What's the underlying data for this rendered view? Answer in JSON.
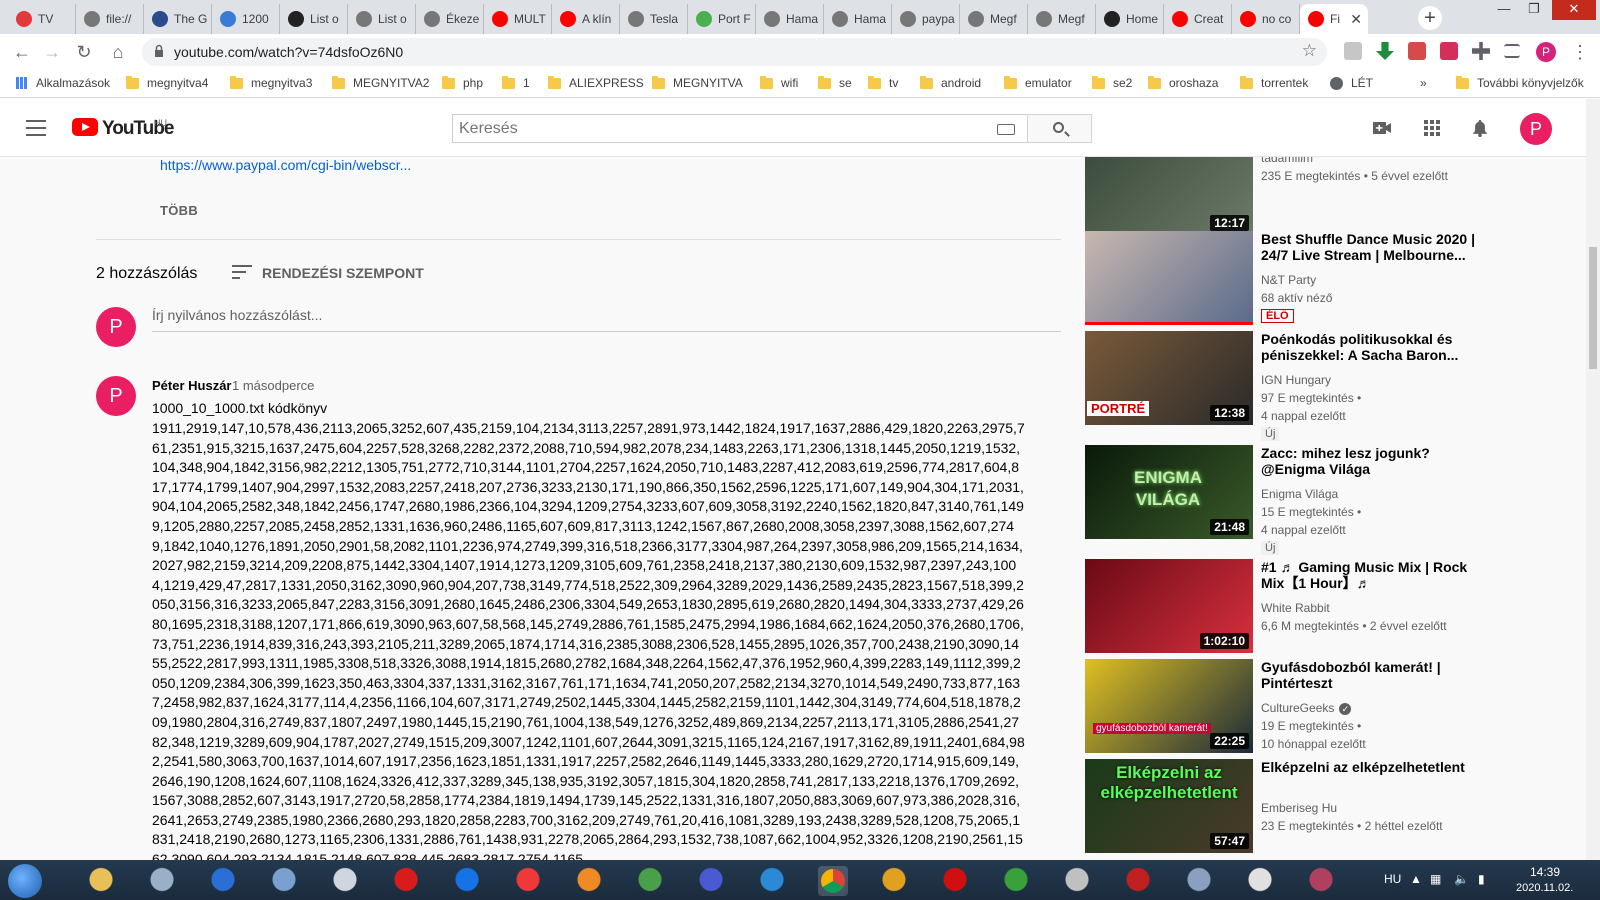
{
  "browser": {
    "tabs": [
      {
        "label": "TV",
        "favicon_color": "#e23a3a"
      },
      {
        "label": "file://",
        "favicon_color": "#777777"
      },
      {
        "label": "The G",
        "favicon_color": "#2a4b8d"
      },
      {
        "label": "1200",
        "favicon_color": "#3a7bd5"
      },
      {
        "label": "List o",
        "favicon_color": "#222222"
      },
      {
        "label": "List o",
        "favicon_color": "#777777"
      },
      {
        "label": "Ékeze",
        "favicon_color": "#777777"
      },
      {
        "label": "MULT",
        "favicon_color": "#ff0000"
      },
      {
        "label": "A klín",
        "favicon_color": "#ff0000"
      },
      {
        "label": "Tesla",
        "favicon_color": "#777777"
      },
      {
        "label": "Port F",
        "favicon_color": "#4caf50"
      },
      {
        "label": "Hama",
        "favicon_color": "#777777"
      },
      {
        "label": "Hama",
        "favicon_color": "#777777"
      },
      {
        "label": "paypa",
        "favicon_color": "#777777"
      },
      {
        "label": "Megf",
        "favicon_color": "#777777"
      },
      {
        "label": "Megf",
        "favicon_color": "#777777"
      },
      {
        "label": "Home",
        "favicon_color": "#222222"
      },
      {
        "label": "Creat",
        "favicon_color": "#ff0000"
      },
      {
        "label": "no co",
        "favicon_color": "#ff0000"
      },
      {
        "label": "Fi",
        "favicon_color": "#ff0000"
      }
    ],
    "new_tab": "+",
    "url": "youtube.com/watch?v=74dsfoOz6N0",
    "bookmarks": [
      "Alkalmazások",
      "megnyitva4",
      "megnyitva3",
      "MEGNYITVA2",
      "php",
      "1",
      "ALIEXPRESS",
      "MEGNYITVA",
      "wifi",
      "se",
      "tv",
      "android",
      "emulator",
      "se2",
      "oroshaza",
      "torrentek",
      "LÉT",
      "»",
      "További könyvjelzők"
    ],
    "profile_letter": "P"
  },
  "youtube": {
    "logo_text": "YouTube",
    "country_code": "HU",
    "search_placeholder": "Keresés",
    "avatar_letter": "P"
  },
  "main": {
    "desc_link": "https://www.paypal.com/cgi-bin/webscr...",
    "more_label": "TÖBB",
    "comment_count": "2 hozzászólás",
    "sort_label": "RENDEZÉSI SZEMPONT",
    "add_comment_placeholder": "Írj nyilvános hozzászólást...",
    "add_avatar": "P",
    "comment": {
      "avatar": "P",
      "author": "Péter Huszár",
      "time": "1 másodperce",
      "title": "1000_10_1000.txt kódkönyv",
      "body": "1911,2919,147,10,578,436,2113,2065,3252,607,435,2159,104,2134,3113,2257,2891,973,1442,1824,1917,1637,2886,429,1820,2263,2975,761,2351,915,3215,1637,2475,604,2257,528,3268,2282,2372,2088,710,594,982,2078,234,1483,2263,171,2306,1318,1445,2050,1219,1532,104,348,904,1842,3156,982,2212,1305,751,2772,710,3144,1101,2704,2257,1624,2050,710,1483,2287,412,2083,619,2596,774,2817,604,817,1774,1799,1407,904,2997,1532,2083,2257,2418,207,2736,3233,2130,171,190,866,350,1562,2596,1225,171,607,149,904,304,171,2031,904,104,2065,2582,348,1842,2456,1747,2680,1986,2366,104,3294,1209,2754,3233,607,609,3058,3192,2240,1562,1820,847,3140,761,1499,1205,2880,2257,2085,2458,2852,1331,1636,960,2486,1165,607,609,817,3113,1242,1567,867,2680,2008,3058,2397,3088,1562,607,2749,1842,1040,1276,1891,2050,2901,58,2082,1101,2236,974,2749,399,316,518,2366,3177,3304,987,264,2397,3058,986,209,1565,214,1634,2027,982,2159,3214,209,2208,875,1442,3304,1407,1914,1273,1209,3105,609,761,2358,2418,2137,380,2130,609,1532,987,2397,243,1004,1219,429,47,2817,1331,2050,3162,3090,960,904,207,738,3149,774,518,2522,309,2964,3289,2029,1436,2589,2435,2823,1567,518,399,2050,3156,316,3233,2065,847,2283,3156,3091,2680,1645,2486,2306,3304,549,2653,1830,2895,619,2680,2820,1494,304,3333,2737,429,2680,1695,2318,3188,1207,171,866,619,3090,963,607,58,568,145,2749,2886,761,1585,2475,2994,1986,1684,662,1624,2050,376,2680,1706,73,751,2236,1914,839,316,243,393,2105,211,3289,2065,1874,1714,316,2385,3088,2306,528,1455,2895,1026,357,700,2438,2190,3090,1455,2522,2817,993,1311,1985,3308,518,3326,3088,1914,1815,2680,2782,1684,348,2264,1562,47,376,1952,960,4,399,2283,149,1112,399,2050,1209,2384,306,399,1623,350,463,3304,337,1331,3162,3167,761,171,1634,741,2050,207,2582,2134,3270,1014,549,2490,733,877,1637,2458,982,837,1624,3177,114,4,2356,1166,104,607,3171,2749,2502,1445,3304,1445,2582,2159,1101,1442,304,3149,774,604,518,1878,209,1980,2804,316,2749,837,1807,2497,1980,1445,15,2190,761,1004,138,549,1276,3252,489,869,2134,2257,2113,171,3105,2886,2541,2782,348,1219,3289,609,904,1787,2027,2749,1515,209,3007,1242,1101,607,2644,3091,3215,1165,124,2167,1917,3162,89,1911,2401,684,982,2541,580,3063,700,1637,1014,607,1917,2356,1623,1851,1331,1917,2257,2582,2646,1149,1445,3333,280,1629,2720,1714,915,609,149,2646,190,1208,1624,607,1108,1624,3326,412,337,3289,345,138,935,3192,3057,1815,304,1820,2858,741,2817,133,2218,1376,1709,2692,1567,3088,2852,607,3143,1917,2720,58,2858,1774,2384,1819,1494,1739,145,2522,1331,316,1807,2050,883,3069,607,973,386,2028,316,2641,2653,2749,2385,1980,2366,2680,293,1820,2858,2283,700,3162,209,2749,761,20,416,1081,3289,193,2438,3289,528,1208,75,2065,1831,2418,2190,2680,1273,1165,2306,1331,2886,761,1438,931,2278,2065,2864,293,1532,738,1087,662,1004,952,3326,1208,2190,2561,1562,3090,604,293,2134,1815,2148,607,828,445,2683,2817,2754,1165"
    }
  },
  "sidebar": {
    "videos": [
      {
        "title": "",
        "channel": "tadamfilm",
        "meta1": "235 E megtekintés • 5 évvel ezelőtt",
        "meta2": "",
        "duration": "12:17",
        "badge": "",
        "thumb_colors": [
          "#3a4a3a",
          "#6c7a68"
        ]
      },
      {
        "title": "Best Shuffle Dance Music 2020 | 24/7 Live Stream | Melbourne...",
        "channel": "N&T Party",
        "meta1": "68 aktív néző",
        "meta2": "",
        "duration": "",
        "badge": "ÉLŐ",
        "thumb_colors": [
          "#c8b8b0",
          "#5a6a8a"
        ]
      },
      {
        "title": "Poénkodás politikusokkal és péniszekkel: A Sacha Baron...",
        "channel": "IGN Hungary",
        "meta1": "97 E megtekintés •",
        "meta2": "4 nappal ezelőtt",
        "duration": "12:38",
        "badge": "Új",
        "overlay": "PORTRÉ",
        "thumb_colors": [
          "#7a5a3a",
          "#2a2a2a"
        ]
      },
      {
        "title": "Zacc: mihez lesz jogunk? @Enigma Világa",
        "channel": "Enigma Világa",
        "meta1": "15 E megtekintés •",
        "meta2": "4 nappal ezelőtt",
        "duration": "21:48",
        "badge": "Új",
        "overlay": "ENIGMA VILÁGA",
        "thumb_colors": [
          "#0a1a0a",
          "#3a5a2a"
        ]
      },
      {
        "title": "#1 ♬ Gaming Music Mix | Rock Mix【1 Hour】♬",
        "channel": "White Rabbit",
        "meta1": "6,6 M megtekintés • 2 évvel ezelőtt",
        "meta2": "",
        "duration": "1:02:10",
        "badge": "",
        "thumb_colors": [
          "#6a0a14",
          "#d83040"
        ]
      },
      {
        "title": "Gyufásdobozból kamerát! | Pintérteszt",
        "channel": "CultureGeeks",
        "meta1": "19 E megtekintés •",
        "meta2": "10 hónappal ezelőtt",
        "duration": "22:25",
        "badge": "",
        "overlay": "gyufásdobozból kamerát!",
        "verified": "✓",
        "thumb_colors": [
          "#e0c020",
          "#1a2a3a"
        ]
      },
      {
        "title": "Elképzelni az elképzelhetetlent",
        "channel": "Emberiseg Hu",
        "meta1": "23 E megtekintés • 2 héttel ezelőtt",
        "meta2": "",
        "duration": "57:47",
        "badge": "",
        "overlay": "Elképzelni az elképzelhetetlent",
        "thumb_colors": [
          "#1a3a1a",
          "#4a3a2a"
        ]
      }
    ]
  },
  "taskbar": {
    "lang": "HU",
    "time": "14:39",
    "date": "2020.11.02."
  }
}
